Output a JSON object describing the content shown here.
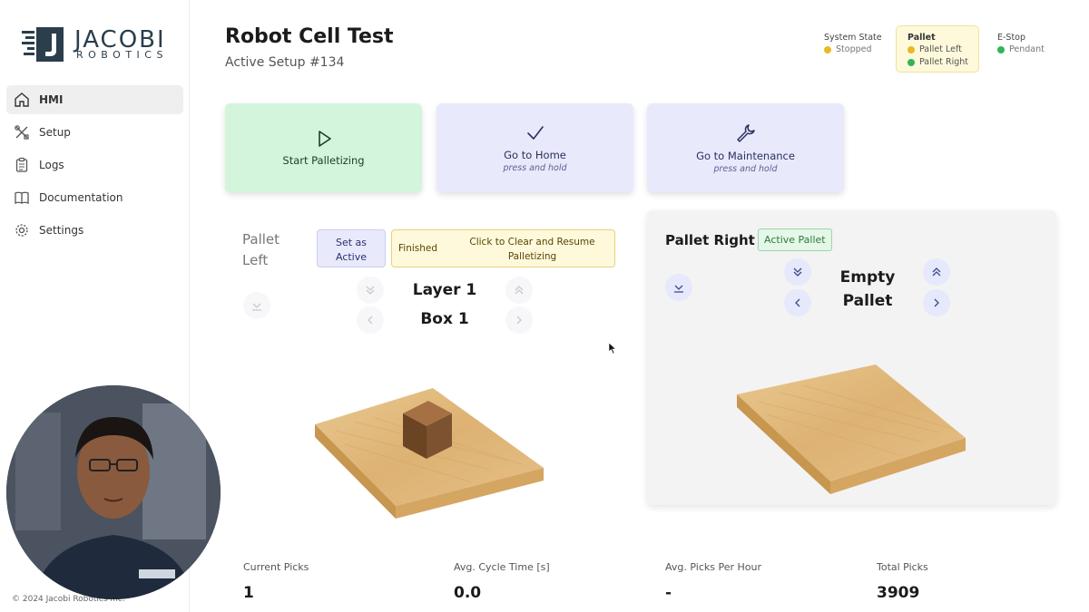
{
  "brand": {
    "name": "JACOBI",
    "sub": "ROBOTICS"
  },
  "sidebar": {
    "items": [
      {
        "label": "HMI",
        "icon": "home-icon",
        "active": true
      },
      {
        "label": "Setup",
        "icon": "tools-icon"
      },
      {
        "label": "Logs",
        "icon": "clipboard-icon"
      },
      {
        "label": "Documentation",
        "icon": "book-icon"
      },
      {
        "label": "Settings",
        "icon": "gear-icon"
      }
    ],
    "copyright": "© 2024 Jacobi Robotics Inc."
  },
  "header": {
    "title": "Robot Cell Test",
    "subtitle": "Active Setup #134"
  },
  "status": {
    "system_state": {
      "label": "System State",
      "value": "Stopped",
      "color": "#e8b923"
    },
    "pallet": {
      "label": "Pallet",
      "items": [
        {
          "value": "Pallet Left",
          "color": "#e8b923"
        },
        {
          "value": "Pallet Right",
          "color": "#34b45a"
        }
      ]
    },
    "estop": {
      "label": "E-Stop",
      "value": "Pendant",
      "color": "#34b45a"
    }
  },
  "actions": {
    "start": {
      "label": "Start Palletizing"
    },
    "home": {
      "label": "Go to Home",
      "sub": "press and hold"
    },
    "maintenance": {
      "label": "Go to Maintenance",
      "sub": "press and hold"
    }
  },
  "pallet_left": {
    "title_line1": "Pallet",
    "title_line2": "Left",
    "set_active_line1": "Set as",
    "set_active_line2": "Active",
    "finished_label": "Finished",
    "clear_line1": "Click to Clear and Resume",
    "clear_line2": "Palletizing",
    "layer": "Layer 1",
    "box": "Box 1"
  },
  "pallet_right": {
    "title": "Pallet Right",
    "badge": "Active Pallet",
    "empty_line1": "Empty",
    "empty_line2": "Pallet"
  },
  "stats": [
    {
      "label": "Current Picks",
      "value": "1"
    },
    {
      "label": "Avg. Cycle Time [s]",
      "value": "0.0"
    },
    {
      "label": "Avg. Picks Per Hour",
      "value": "-"
    },
    {
      "label": "Total Picks",
      "value": "3909"
    }
  ],
  "colors": {
    "accent_green": "#d3f5dc",
    "accent_blue": "#e8eafc",
    "warning_yellow": "#fef9db"
  }
}
